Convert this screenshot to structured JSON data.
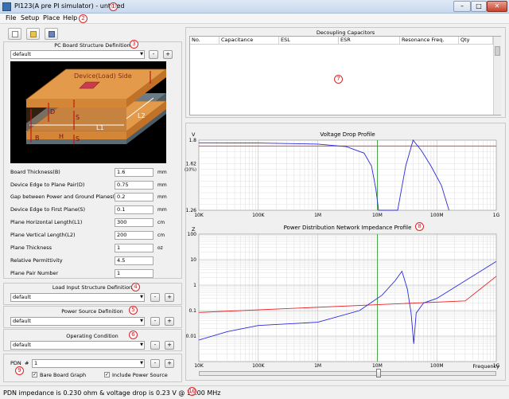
{
  "window": {
    "title": "PI123(A pre PI simulator) - untitled",
    "min_label": "–",
    "max_label": "□",
    "close_label": "✕"
  },
  "callouts": [
    "1",
    "2",
    "3",
    "4",
    "5",
    "6",
    "7",
    "8",
    "9",
    "10"
  ],
  "menu": [
    "File",
    "Setup",
    "Place",
    "Help"
  ],
  "toolbar": [
    {
      "icon": "new-file-icon"
    },
    {
      "icon": "open-folder-icon"
    },
    {
      "icon": "save-disk-icon"
    }
  ],
  "pcb": {
    "title": "PC Board Structure Definition",
    "selected": "default",
    "minus": "-",
    "plus": "+",
    "diagram_labels": {
      "side": "Device(Load) Side",
      "L1": "L1",
      "L2": "L2",
      "D": "D",
      "S1": "S",
      "H": "H",
      "B": "B",
      "S2": "S"
    },
    "params": [
      {
        "label": "Board Thickness(B)",
        "value": "1.6",
        "unit": "mm"
      },
      {
        "label": "Device Edge to Plane Pair(D)",
        "value": "0.75",
        "unit": "mm"
      },
      {
        "label": "Gap between Power and Ground Planes(H)",
        "value": "0.2",
        "unit": "mm"
      },
      {
        "label": "Device Edge to First Plane(S)",
        "value": "0.1",
        "unit": "mm"
      },
      {
        "label": "Plane Horizontal Length(L1)",
        "value": "300",
        "unit": "cm"
      },
      {
        "label": "Plane Vertical Length(L2)",
        "value": "200",
        "unit": "cm"
      },
      {
        "label": "Plane Thickness",
        "value": "1",
        "unit": "oz"
      },
      {
        "label": "Relative Permittivity",
        "value": "4.5",
        "unit": ""
      },
      {
        "label": "Plane Pair Number",
        "value": "1",
        "unit": ""
      }
    ]
  },
  "load": {
    "title": "Load Input Structure Definition",
    "selected": "default",
    "minus": "-",
    "plus": "+"
  },
  "power": {
    "title": "Power Source Definition",
    "selected": "default",
    "minus": "-",
    "plus": "+"
  },
  "operating": {
    "title": "Operating Condition",
    "selected": "default",
    "minus": "-",
    "plus": "+"
  },
  "pdn": {
    "label": "PDN",
    "hash": "#",
    "selected": "1",
    "minus": "-",
    "plus": "+",
    "bare_board": {
      "label": "Bare Board Graph",
      "checked": true,
      "mark": "✓"
    },
    "include_power": {
      "label": "Include Power Source",
      "checked": true,
      "mark": "✓"
    }
  },
  "decap": {
    "title": "Decoupling Capacitors",
    "columns": [
      "No.",
      "Capacitance",
      "ESL",
      "ESR",
      "Resonance Freq.",
      "Qty"
    ]
  },
  "colors": {
    "series_red": "#e8272b",
    "series_blue": "#2a2ae0",
    "marker_green": "#1d9a1d",
    "board_orange": "#e39a4a"
  },
  "chart_data": [
    {
      "type": "line",
      "title": "Voltage Drop Profile",
      "ylabel": "V",
      "xlabel": "",
      "x_scale": "log",
      "xlim": [
        10000,
        1000000000
      ],
      "ylim": [
        1.26,
        1.8
      ],
      "x_tick_labels": [
        "10K",
        "100K",
        "1M",
        "10M",
        "100M",
        "1G"
      ],
      "y_tick_labels": [
        "1.8",
        "1.62",
        "(10%)",
        "1.26"
      ],
      "x_marker": 10000000,
      "series": [
        {
          "color": "red",
          "points": [
            [
              10000,
              1.755
            ],
            [
              1000000000,
              1.755
            ]
          ]
        },
        {
          "color": "blue",
          "points": [
            [
              10000,
              1.78
            ],
            [
              100000,
              1.778
            ],
            [
              1000000,
              1.77
            ],
            [
              3000000,
              1.75
            ],
            [
              6000000,
              1.7
            ],
            [
              8000000,
              1.6
            ],
            [
              9500000,
              1.42
            ],
            [
              10500000,
              1.26
            ],
            [
              22000000,
              1.26
            ],
            [
              30000000,
              1.6
            ],
            [
              40000000,
              1.8
            ],
            [
              55000000,
              1.72
            ],
            [
              80000000,
              1.6
            ],
            [
              120000000,
              1.45
            ],
            [
              160000000,
              1.26
            ]
          ]
        }
      ]
    },
    {
      "type": "line",
      "title": "Power Distribution Network Impedance Profile",
      "ylabel": "Z",
      "xlabel": "Frequency",
      "x_scale": "log",
      "y_scale": "log",
      "xlim": [
        10000,
        1000000000
      ],
      "ylim": [
        0.001,
        100
      ],
      "x_tick_labels": [
        "10K",
        "100K",
        "1M",
        "10M",
        "100M",
        "1G"
      ],
      "y_tick_labels": [
        "100",
        "10",
        "1",
        "0.1",
        "0.01"
      ],
      "x_marker": 10000000,
      "series": [
        {
          "color": "red",
          "points": [
            [
              10000,
              0.085
            ],
            [
              300000000,
              0.24
            ],
            [
              1000000000,
              2.2
            ]
          ]
        },
        {
          "color": "blue",
          "points": [
            [
              10000,
              0.007
            ],
            [
              30000,
              0.015
            ],
            [
              100000,
              0.026
            ],
            [
              1000000,
              0.035
            ],
            [
              5000000,
              0.1
            ],
            [
              12000000,
              0.4
            ],
            [
              20000000,
              1.5
            ],
            [
              26000000,
              3.5
            ],
            [
              32000000,
              0.7
            ],
            [
              37000000,
              0.08
            ],
            [
              41000000,
              0.005
            ],
            [
              45000000,
              0.08
            ],
            [
              60000000,
              0.2
            ],
            [
              100000000,
              0.3
            ],
            [
              1000000000,
              8.5
            ]
          ]
        }
      ]
    }
  ],
  "status": "PDN impedance is 0.230 ohm & voltage drop is 0.23 V @ 10.00 MHz"
}
